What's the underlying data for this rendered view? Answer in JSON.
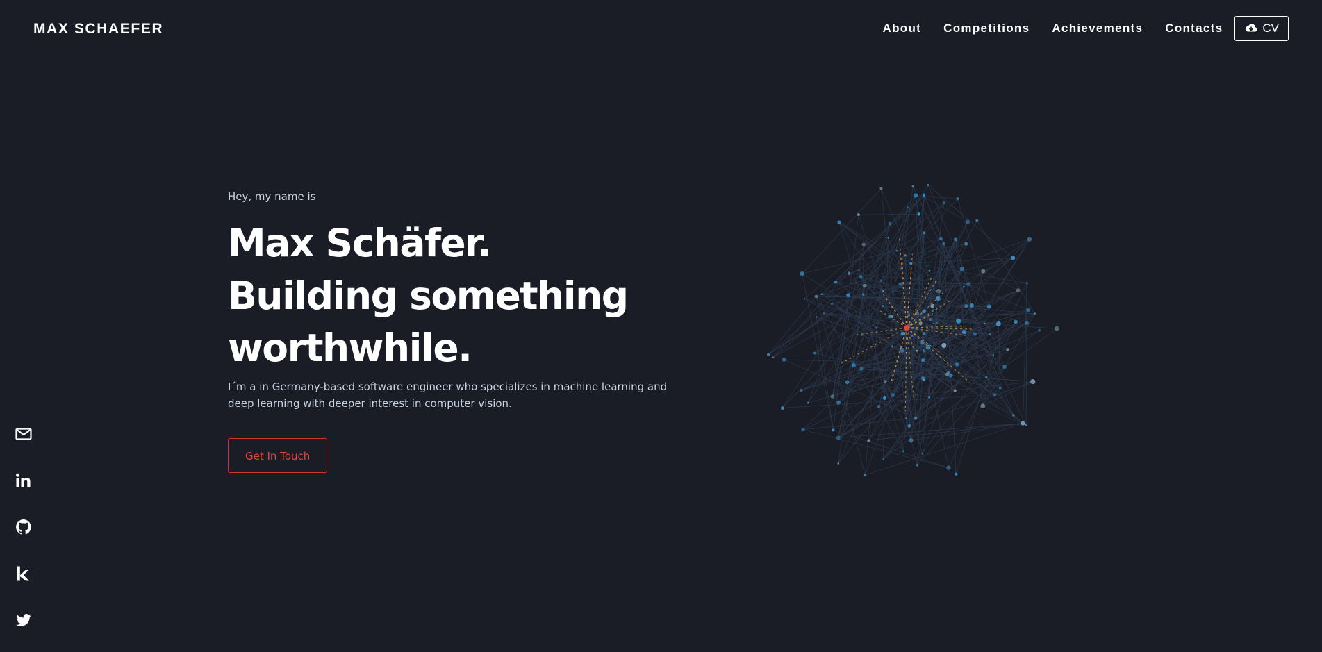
{
  "header": {
    "brand": "MAX SCHAEFER",
    "nav": {
      "about": "About",
      "competitions": "Competitions",
      "achievements": "Achievements",
      "contacts": "Contacts"
    },
    "cv_label": "CV",
    "cv_icon": "cloud-download-icon"
  },
  "hero": {
    "greeting": "Hey, my name is",
    "name": "Max Schäfer.",
    "tagline_line1": "Building something",
    "tagline_line2": "worthwhile.",
    "description": "I´m a in Germany-based software engineer who specializes in machine learning and deep learning with deeper interest in computer vision.",
    "cta_label": "Get In Touch"
  },
  "social": {
    "icons": [
      "envelope-icon",
      "linkedin-icon",
      "github-icon",
      "kaggle-icon",
      "twitter-icon"
    ]
  },
  "colors": {
    "background": "#1a1d25",
    "text": "#ffffff",
    "muted_text": "#c9d3e3",
    "accent": "#e04a3a",
    "node_blue": "#3d8fc4",
    "edge_orange": "#e0a040",
    "edge_dim": "#2c3a50"
  }
}
